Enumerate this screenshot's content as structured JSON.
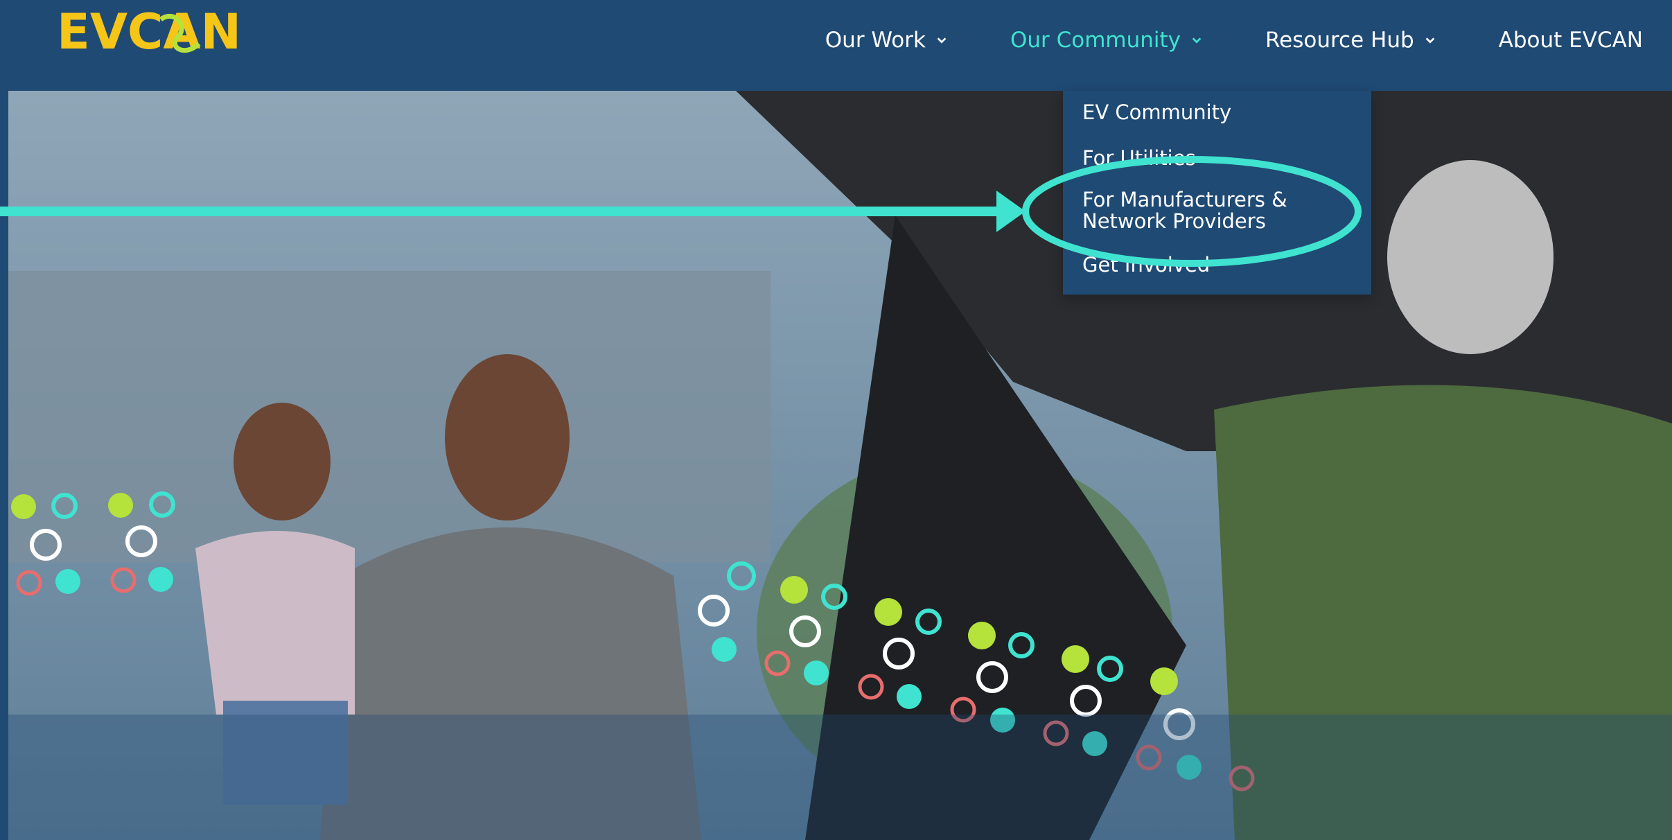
{
  "brand": {
    "logo_text": "EVCAN",
    "colors": {
      "navy": "#1f4a74",
      "teal": "#3fe3cf",
      "yellow": "#f5c518",
      "lime": "#b5e23b"
    }
  },
  "nav": {
    "items": [
      {
        "label": "Our Work",
        "has_dropdown": true,
        "active": false
      },
      {
        "label": "Our Community",
        "has_dropdown": true,
        "active": true
      },
      {
        "label": "Resource Hub",
        "has_dropdown": true,
        "active": false
      },
      {
        "label": "About EVCAN",
        "has_dropdown": false,
        "active": false
      }
    ]
  },
  "dropdown": {
    "items": [
      {
        "label": "EV Community"
      },
      {
        "label": "For Utilities"
      },
      {
        "label": "For Manufacturers & Network Providers"
      },
      {
        "label": "Get Involved"
      }
    ]
  },
  "annotation": {
    "type": "arrow-and-ellipse",
    "color": "#3fe3cf",
    "highlighted_item": "For Manufacturers & Network Providers"
  },
  "hero": {
    "icons": [
      "chevron-down-icon"
    ]
  }
}
